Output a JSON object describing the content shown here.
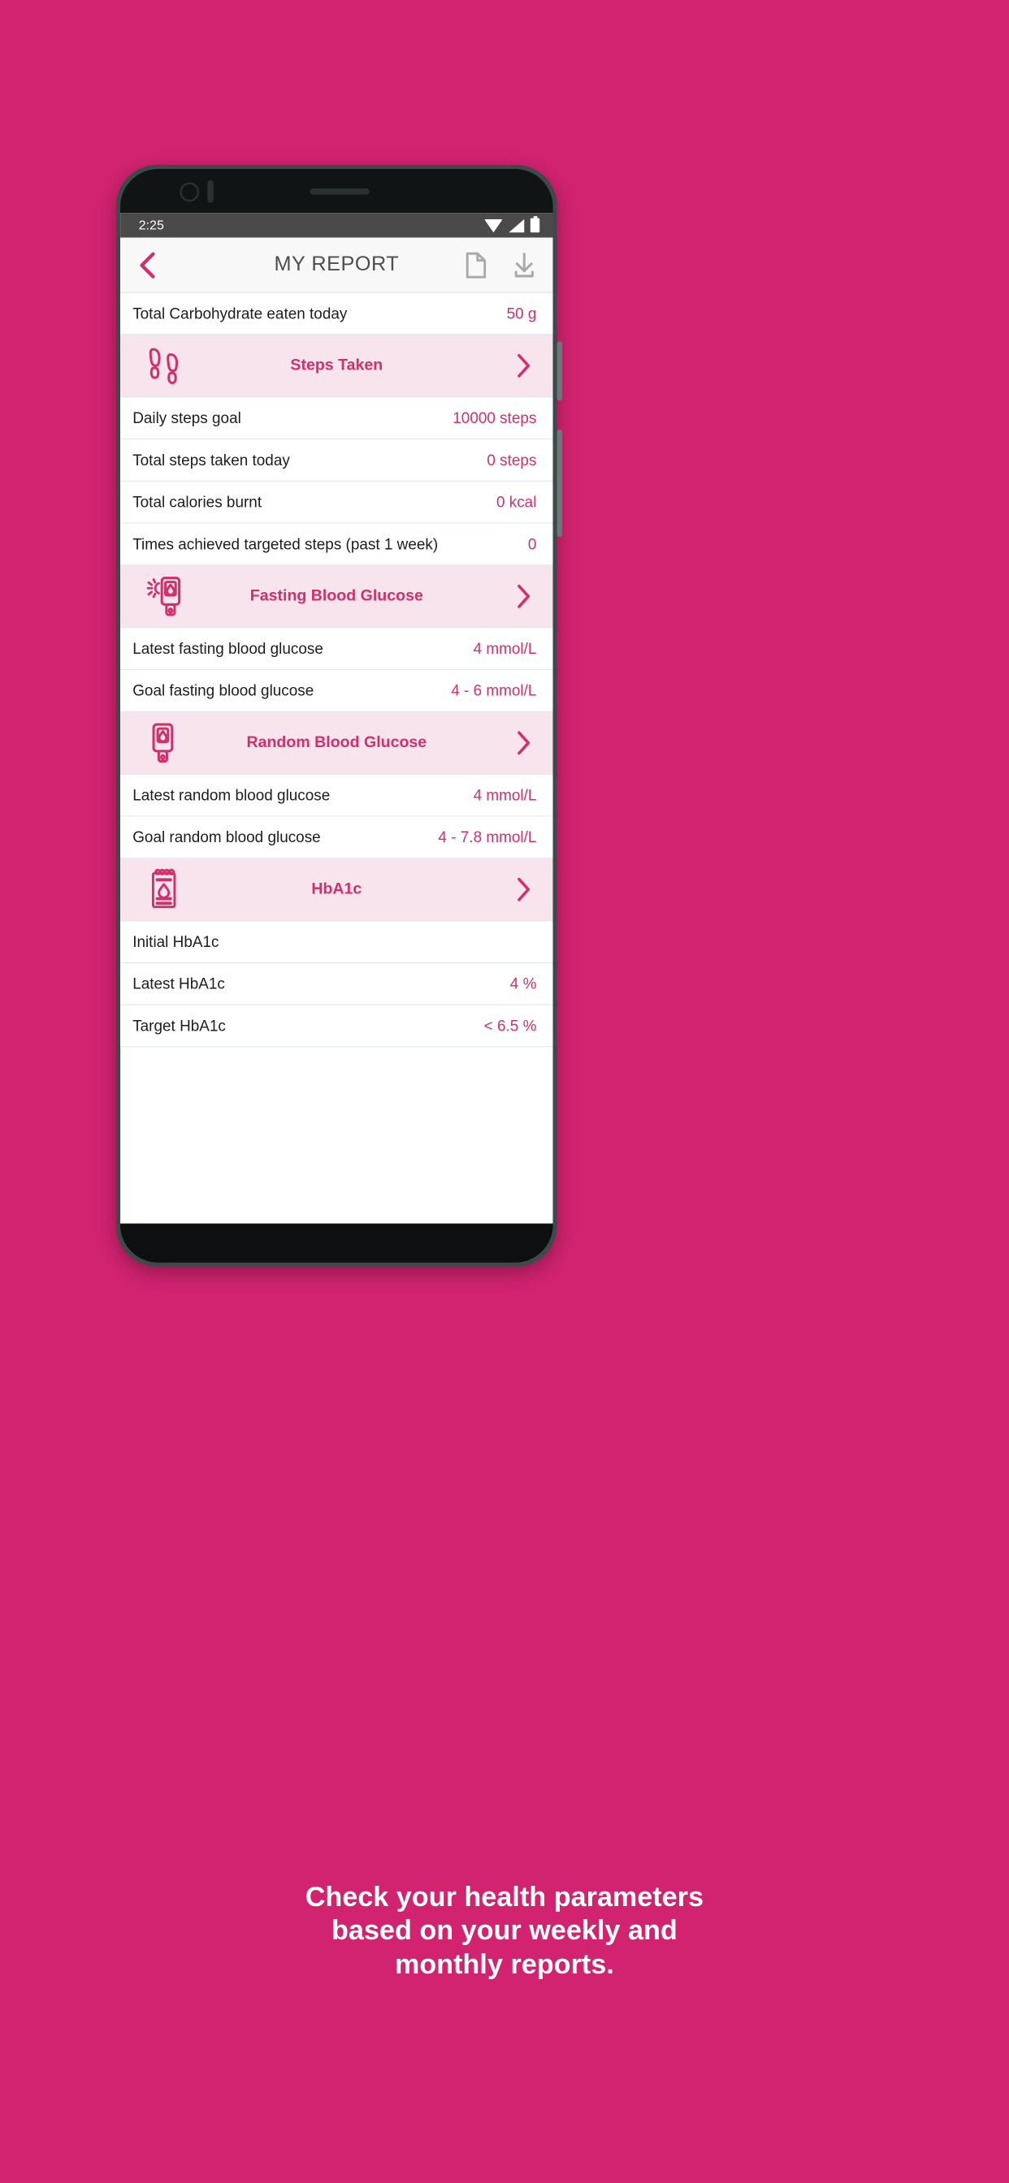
{
  "device": {
    "statusbar": {
      "time": "2:25",
      "icons": [
        "wifi-icon",
        "signal-icon",
        "battery-icon"
      ]
    }
  },
  "header": {
    "back_icon": "chevron-left-icon",
    "title": "MY REPORT",
    "actions": [
      {
        "name": "document-icon",
        "label": "Document"
      },
      {
        "name": "download-icon",
        "label": "Download"
      }
    ]
  },
  "theme": {
    "brand_pink": "#d12370",
    "accent_pink": "#d1306c",
    "section_bg": "#f7e4ec",
    "divider": "#e3e8f0",
    "appbar_bg": "#f8f8f8",
    "statusbar_bg": "#4a4a4a"
  },
  "report": {
    "top_rows": [
      {
        "label": "Total Carbohydrate eaten today",
        "value": "50 g"
      }
    ],
    "sections": [
      {
        "title": "Steps Taken",
        "icon": "footprints-icon",
        "chevron": "chevron-right-icon",
        "rows": [
          {
            "label": "Daily steps goal",
            "value": "10000 steps"
          },
          {
            "label": "Total steps taken today",
            "value": "0 steps"
          },
          {
            "label": "Total calories burnt",
            "value": "0 kcal"
          },
          {
            "label": "Times achieved targeted steps (past 1 week)",
            "value": "0"
          }
        ]
      },
      {
        "title": "Fasting Blood Glucose",
        "icon": "glucometer-sun-icon",
        "chevron": "chevron-right-icon",
        "rows": [
          {
            "label": "Latest fasting blood glucose",
            "value": "4 mmol/L"
          },
          {
            "label": "Goal fasting blood glucose",
            "value": "4 - 6 mmol/L"
          }
        ]
      },
      {
        "title": "Random Blood Glucose",
        "icon": "glucometer-icon",
        "chevron": "chevron-right-icon",
        "rows": [
          {
            "label": "Latest random blood glucose",
            "value": "4 mmol/L"
          },
          {
            "label": "Goal random blood glucose",
            "value": "4 - 7.8 mmol/L"
          }
        ]
      },
      {
        "title": "HbA1c",
        "icon": "lab-report-drop-icon",
        "chevron": "chevron-right-icon",
        "rows": [
          {
            "label": "Initial HbA1c",
            "value": ""
          },
          {
            "label": "Latest HbA1c",
            "value": "4 %"
          },
          {
            "label": "Target HbA1c",
            "value": "< 6.5 %"
          }
        ]
      }
    ]
  },
  "caption": {
    "lines": [
      "Check your health parameters",
      "based on your weekly and",
      "monthly reports."
    ]
  }
}
